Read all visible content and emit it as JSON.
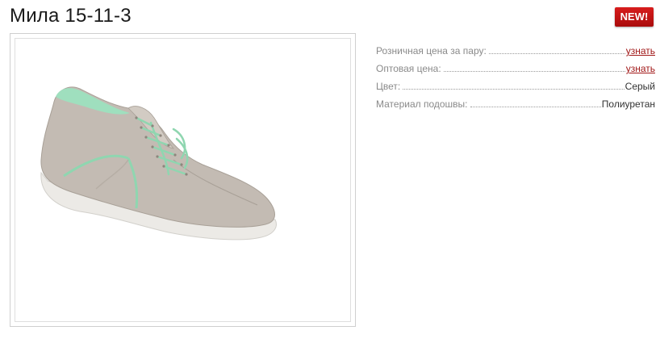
{
  "product": {
    "title": "Мила 15-11-3",
    "badge": "NEW!",
    "image_alt": "shoe-photo"
  },
  "properties": [
    {
      "label": "Розничная цена за пару:",
      "value": "узнать",
      "is_link": true
    },
    {
      "label": "Оптовая цена:",
      "value": "узнать",
      "is_link": true
    },
    {
      "label": "Цвет:",
      "value": "Серый",
      "is_link": false
    },
    {
      "label": "Материал подошвы:",
      "value": "Полиуретан",
      "is_link": false
    }
  ],
  "colors": {
    "link": "#a11818",
    "badge": "#c51111",
    "label": "#8a8a8a",
    "shoe_upper": "#c4bcb4",
    "shoe_accent": "#8fd6b0",
    "sole": "#ecebe8"
  }
}
